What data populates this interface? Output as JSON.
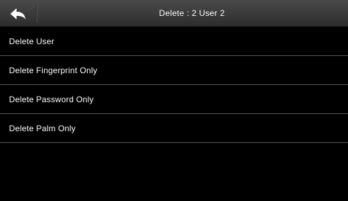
{
  "header": {
    "back_icon": "back-arrow-icon",
    "title": "Delete : 2 User 2"
  },
  "menu": {
    "items": [
      {
        "label": "Delete User"
      },
      {
        "label": "Delete Fingerprint Only"
      },
      {
        "label": "Delete Password Only"
      },
      {
        "label": "Delete Palm Only"
      }
    ]
  },
  "colors": {
    "background": "#000000",
    "header": "#3a3a3a",
    "divider": "#5a5a5a",
    "text": "#ffffff"
  }
}
